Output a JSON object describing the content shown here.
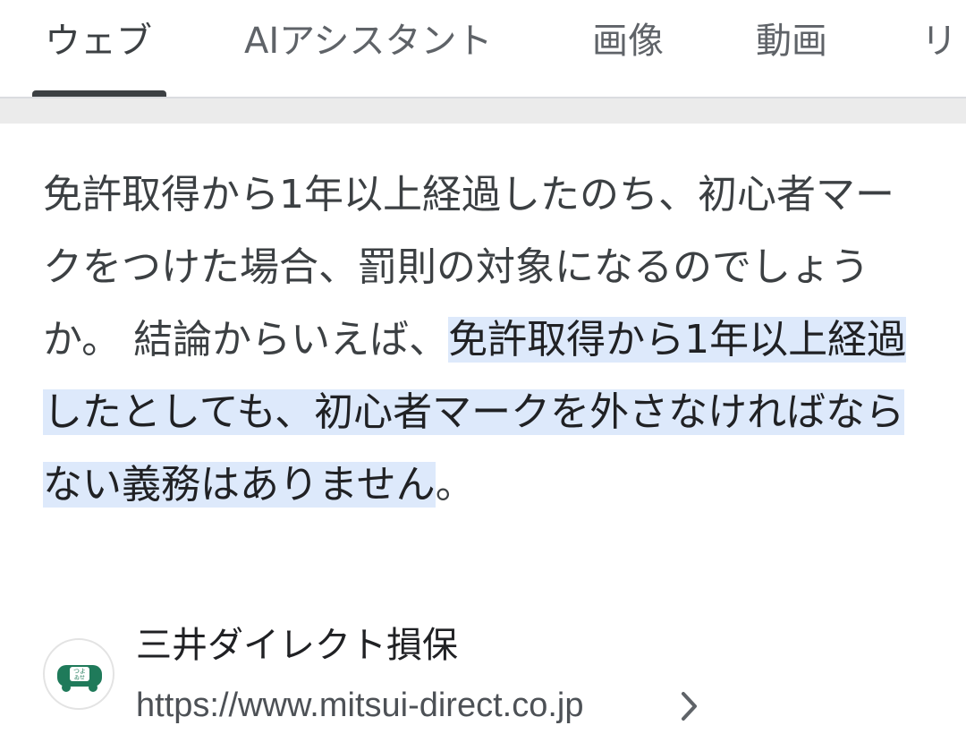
{
  "tabs": [
    {
      "label": "ウェブ",
      "active": true
    },
    {
      "label": "AIアシスタント",
      "active": false
    },
    {
      "label": "画像",
      "active": false
    },
    {
      "label": "動画",
      "active": false
    },
    {
      "label": "リ",
      "active": false
    }
  ],
  "snippet": {
    "lead": "免許取得から1年以上経過したのち、初心者マークをつけた場合、罰則の対象になるのでしょうか。 結論からいえば、",
    "highlight": "免許取得から1年以上経過したとしても、初心者マークを外さなければならない義務はありません",
    "tail": "。"
  },
  "source": {
    "site_name": "三井ダイレクト損保",
    "url": "https://www.mitsui-direct.co.jp",
    "favicon_icon": "mitsui-direct-favicon",
    "chevron_icon": "chevron-right-icon"
  },
  "colors": {
    "highlight_bg": "#dde9fb",
    "tab_indicator": "#3c4043",
    "favicon_green": "#1f7a5a"
  }
}
